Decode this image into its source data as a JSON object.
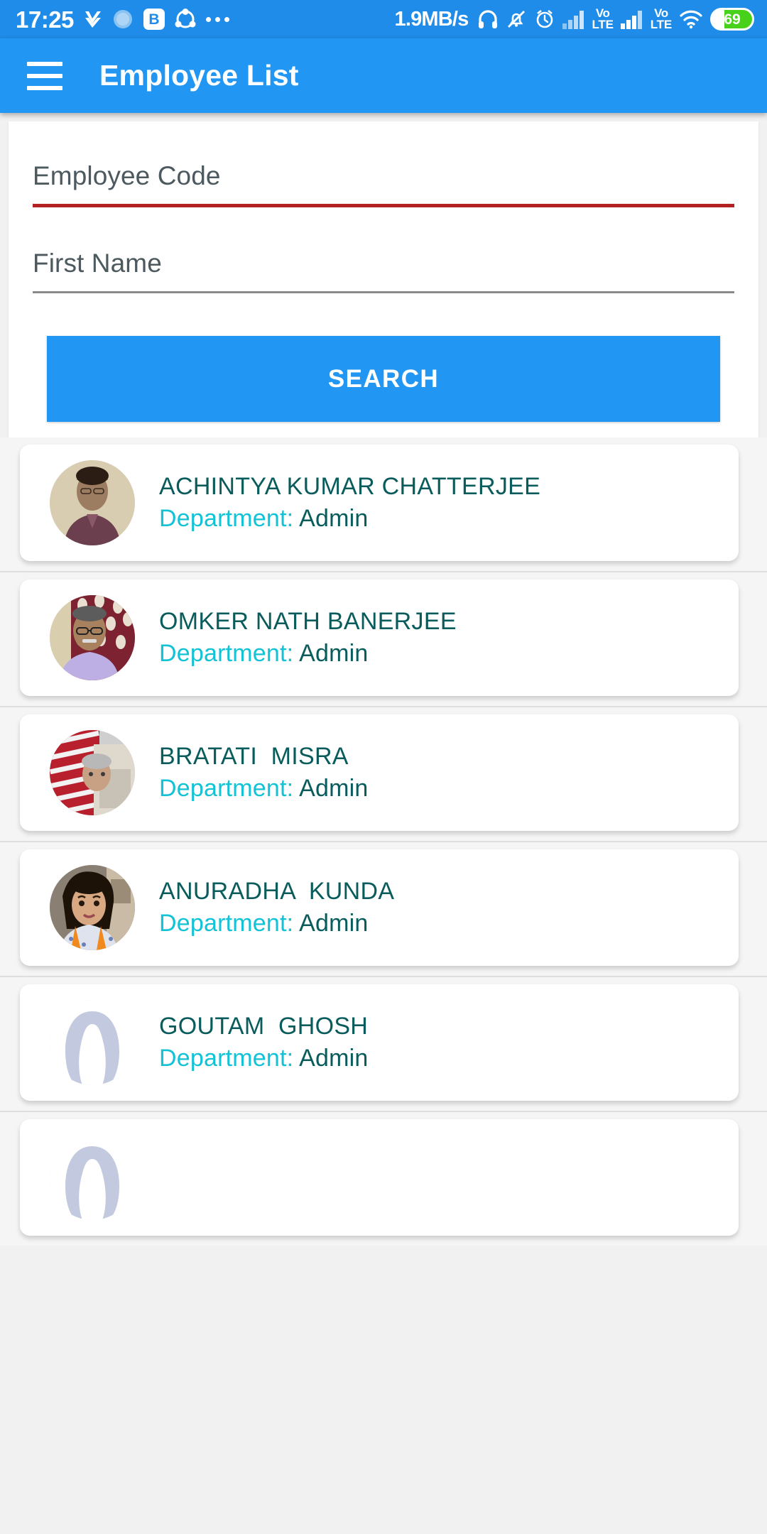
{
  "status_bar": {
    "time": "17:25",
    "network_speed": "1.9MB/s",
    "battery_level": "69",
    "volte_line1": "Vo",
    "volte_line2": "LTE",
    "b_badge": "B",
    "icons": [
      "checkmark-icon",
      "circle-progress-icon",
      "b-app-icon",
      "share-icon",
      "more-dots-icon",
      "headphone-icon",
      "bell-muted-icon",
      "alarm-clock-icon",
      "signal-bars-icon",
      "volte-icon",
      "signal-bars-icon",
      "volte-icon",
      "wifi-icon",
      "battery-icon"
    ],
    "accent": "#1e8ce8"
  },
  "app_bar": {
    "title": "Employee List",
    "menu_icon": "hamburger-menu-icon",
    "background": "#2196f3"
  },
  "search_panel": {
    "employee_code": {
      "label": "Employee Code",
      "value": "",
      "placeholder": "Employee Code",
      "underline_color": "#b22222",
      "state": "error"
    },
    "first_name": {
      "label": "First Name",
      "value": "",
      "placeholder": "First Name",
      "underline_color": "#8a8a8a",
      "state": "normal"
    },
    "search_button": {
      "label": "SEARCH",
      "background": "#2196f3",
      "text_color": "#ffffff"
    }
  },
  "employee_list": {
    "department_label": "Department:",
    "name_color": "#0a5c5c",
    "label_color": "#12c2d6",
    "items": [
      {
        "name": "ACHINTYA KUMAR CHATTERJEE",
        "department": "Admin",
        "avatar": "photo-man-maroon-shirt",
        "has_photo": true
      },
      {
        "name": "OMKER NATH BANERJEE",
        "department": "Admin",
        "avatar": "photo-man-glasses-lavender-shirt",
        "has_photo": true
      },
      {
        "name": "BRATATI  MISRA",
        "department": "Admin",
        "avatar": "photo-striped-red-white",
        "has_photo": true
      },
      {
        "name": "ANURADHA  KUNDA",
        "department": "Admin",
        "avatar": "photo-woman-orange-scarf",
        "has_photo": true
      },
      {
        "name": "GOUTAM  GHOSH",
        "department": "Admin",
        "avatar": "placeholder-person-icon",
        "has_photo": false
      },
      {
        "name": "",
        "department": "",
        "avatar": "placeholder-person-icon",
        "has_photo": false
      }
    ]
  }
}
